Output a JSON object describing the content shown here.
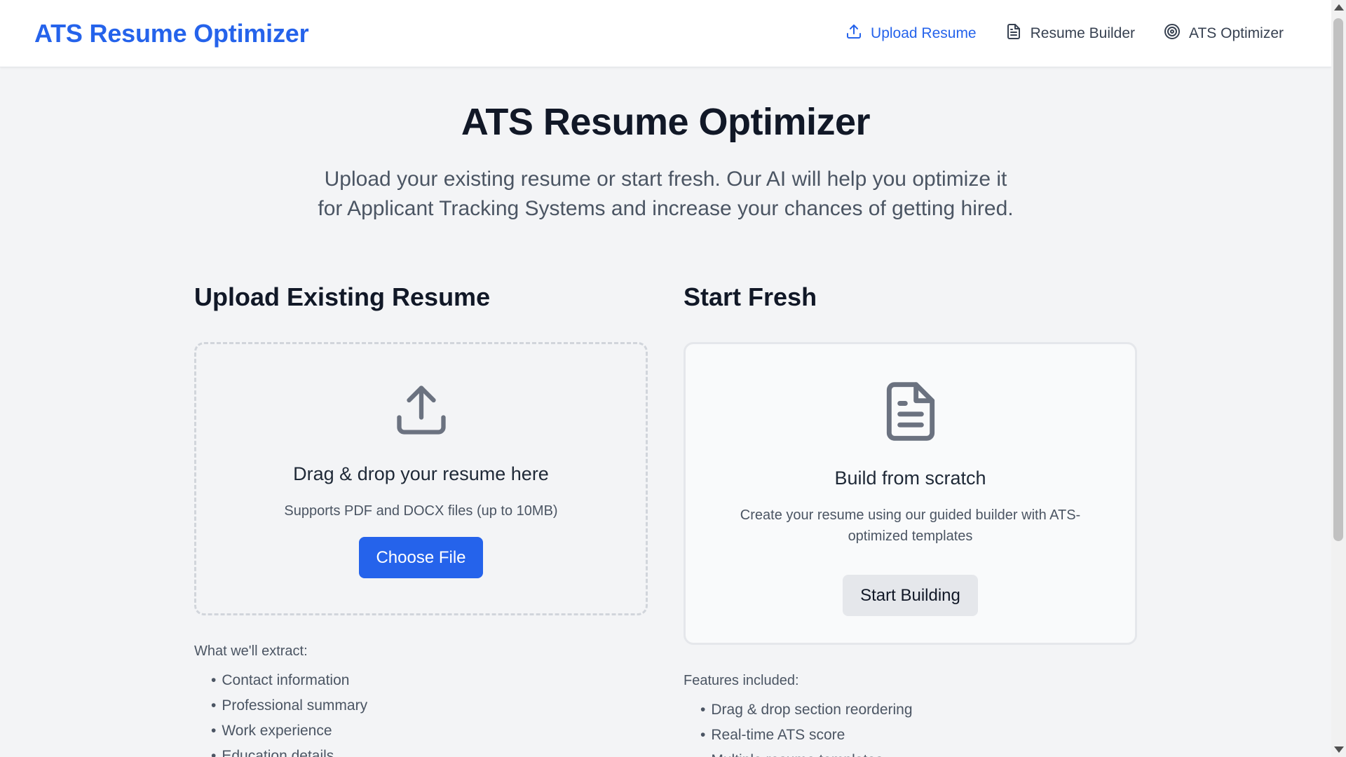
{
  "header": {
    "brand": "ATS Resume Optimizer",
    "nav": [
      {
        "label": "Upload Resume",
        "icon": "upload-icon",
        "active": true
      },
      {
        "label": "Resume Builder",
        "icon": "document-icon",
        "active": false
      },
      {
        "label": "ATS Optimizer",
        "icon": "target-icon",
        "active": false
      }
    ]
  },
  "hero": {
    "title": "ATS Resume Optimizer",
    "subtitle": "Upload your existing resume or start fresh. Our AI will help you optimize it for Applicant Tracking Systems and increase your chances of getting hired."
  },
  "upload": {
    "section_title": "Upload Existing Resume",
    "icon": "upload-icon",
    "heading": "Drag & drop your resume here",
    "description": "Supports PDF and DOCX files (up to 10MB)",
    "button": "Choose File",
    "list_title": "What we'll extract:",
    "items": [
      "Contact information",
      "Professional summary",
      "Work experience",
      "Education details"
    ]
  },
  "fresh": {
    "section_title": "Start Fresh",
    "icon": "document-icon",
    "heading": "Build from scratch",
    "description": "Create your resume using our guided builder with ATS-optimized templates",
    "button": "Start Building",
    "list_title": "Features included:",
    "items": [
      "Drag & drop section reordering",
      "Real-time ATS score",
      "Multiple resume templates"
    ]
  },
  "colors": {
    "accent": "#2563eb",
    "background": "#f3f4f6",
    "text": "#111827",
    "muted": "#4b5563"
  }
}
